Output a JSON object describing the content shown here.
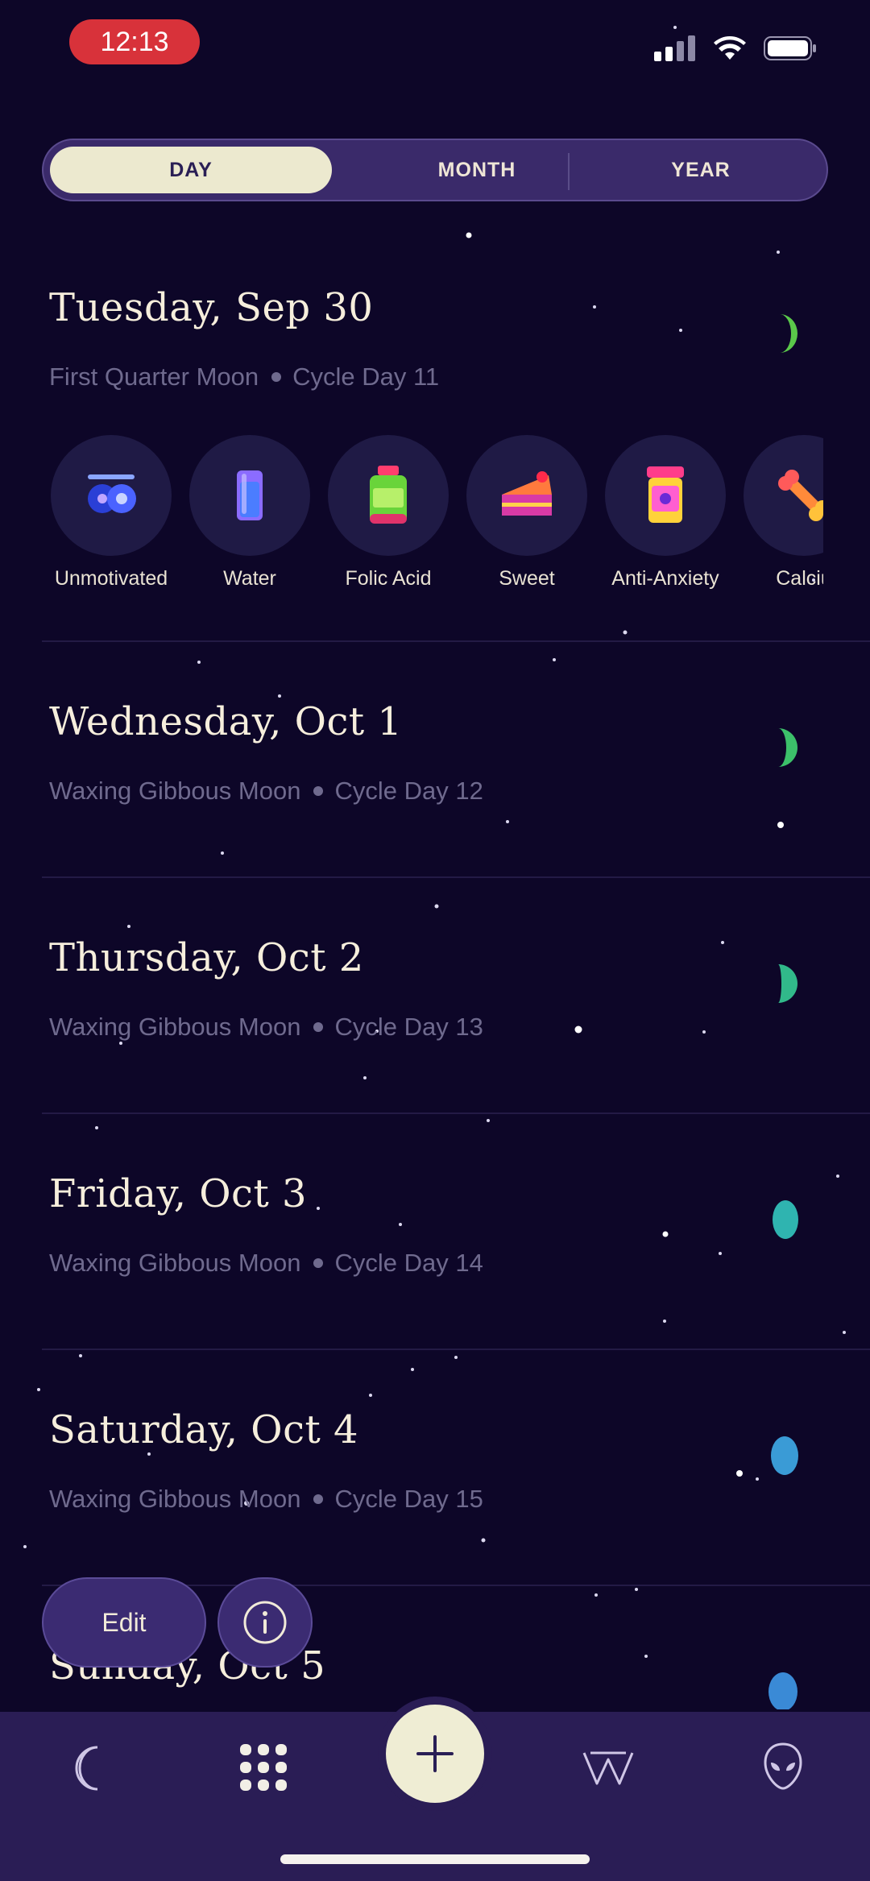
{
  "status_bar": {
    "time": "12:13"
  },
  "view_tabs": [
    {
      "label": "DAY",
      "active": true
    },
    {
      "label": "MONTH",
      "active": false
    },
    {
      "label": "YEAR",
      "active": false
    }
  ],
  "days": [
    {
      "title": "Tuesday, Sep 30",
      "moon_phase": "First Quarter Moon",
      "cycle_day": "Cycle Day 11",
      "moon_color": "#5ac84a"
    },
    {
      "title": "Wednesday, Oct 1",
      "moon_phase": "Waxing Gibbous Moon",
      "cycle_day": "Cycle Day 12",
      "moon_color": "#3cc06a"
    },
    {
      "title": "Thursday, Oct 2",
      "moon_phase": "Waxing Gibbous Moon",
      "cycle_day": "Cycle Day 13",
      "moon_color": "#31b98a"
    },
    {
      "title": "Friday, Oct 3",
      "moon_phase": "Waxing Gibbous Moon",
      "cycle_day": "Cycle Day 14",
      "moon_color": "#2fb4b0"
    },
    {
      "title": "Saturday, Oct 4",
      "moon_phase": "Waxing Gibbous Moon",
      "cycle_day": "Cycle Day 15",
      "moon_color": "#3a9bd6"
    },
    {
      "title": "Sunday, Oct 5",
      "moon_phase": "",
      "cycle_day": "",
      "moon_color": "#3a8ad6"
    }
  ],
  "trackers": [
    {
      "label": "Unmotivated",
      "icon": "unmotivated-icon"
    },
    {
      "label": "Water",
      "icon": "water-glass-icon"
    },
    {
      "label": "Folic Acid",
      "icon": "folic-acid-bottle-icon"
    },
    {
      "label": "Sweet",
      "icon": "cake-slice-icon"
    },
    {
      "label": "Anti-Anxiety",
      "icon": "pill-bottle-icon"
    },
    {
      "label": "Calciu",
      "icon": "bone-icon"
    }
  ],
  "actions": {
    "edit_label": "Edit"
  },
  "bottom_nav": [
    {
      "name": "moon-tab",
      "icon": "crescent-moon-icon"
    },
    {
      "name": "calendar-grid-tab",
      "icon": "grid-dots-icon",
      "active": true
    },
    {
      "name": "add-button",
      "icon": "plus-icon"
    },
    {
      "name": "wisdom-tab",
      "icon": "w-logo-icon"
    },
    {
      "name": "profile-tab",
      "icon": "alien-icon"
    }
  ],
  "colors": {
    "background": "#0d0628",
    "accent": "#ece9cf",
    "nav_bar": "#2a1d55"
  }
}
